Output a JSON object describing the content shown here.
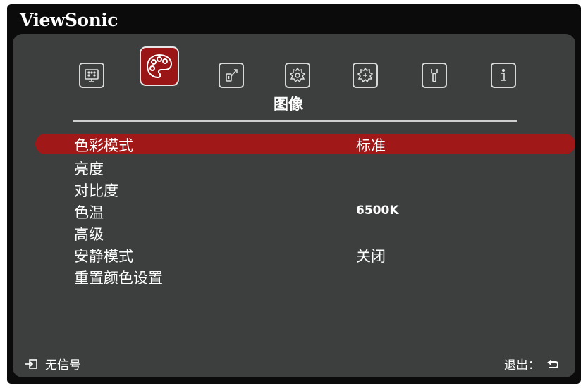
{
  "brand": "ViewSonic",
  "tabs": [
    {
      "id": "display",
      "icon": "display-icon",
      "active": false
    },
    {
      "id": "image",
      "icon": "palette-icon",
      "active": true
    },
    {
      "id": "power",
      "icon": "power-management-icon",
      "active": false
    },
    {
      "id": "basic",
      "icon": "gear-basic-icon",
      "active": false
    },
    {
      "id": "advanced",
      "icon": "gear-advanced-icon",
      "active": false
    },
    {
      "id": "system",
      "icon": "wrench-icon",
      "active": false
    },
    {
      "id": "info",
      "icon": "info-icon",
      "active": false
    }
  ],
  "active_tab_title": "图像",
  "menu": [
    {
      "label": "色彩模式",
      "value": "标准",
      "selected": true
    },
    {
      "label": "亮度",
      "value": ""
    },
    {
      "label": "对比度",
      "value": ""
    },
    {
      "label": "色温",
      "value": "6500K"
    },
    {
      "label": "高级",
      "value": ""
    },
    {
      "label": "安静模式",
      "value": "关闭"
    },
    {
      "label": "重置颜色设置",
      "value": ""
    }
  ],
  "footer": {
    "source_status": "无信号",
    "exit_label": "退出："
  },
  "colors": {
    "highlight": "#a01818",
    "panel": "#3d3f3f",
    "frame": "#0b0b0b"
  }
}
